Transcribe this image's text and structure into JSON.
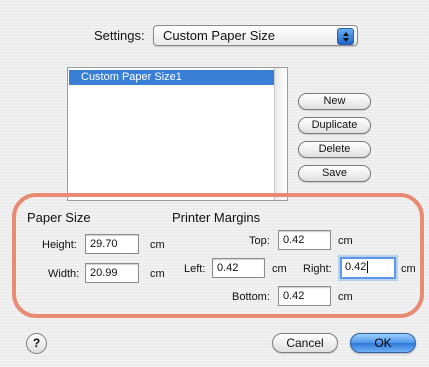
{
  "settings": {
    "label": "Settings:",
    "selected": "Custom Paper Size"
  },
  "list": {
    "items": [
      "Custom Paper Size1"
    ],
    "selected_index": 0
  },
  "side_buttons": {
    "new": "New",
    "duplicate": "Duplicate",
    "delete": "Delete",
    "save": "Save"
  },
  "paper_size": {
    "title": "Paper Size",
    "height_label": "Height:",
    "height_value": "29.70",
    "height_unit": "cm",
    "width_label": "Width:",
    "width_value": "20.99",
    "width_unit": "cm"
  },
  "printer_margins": {
    "title": "Printer Margins",
    "top_label": "Top:",
    "top_value": "0.42",
    "top_unit": "cm",
    "left_label": "Left:",
    "left_value": "0.42",
    "left_unit": "cm",
    "right_label": "Right:",
    "right_value": "0.42",
    "right_unit": "cm",
    "bottom_label": "Bottom:",
    "bottom_value": "0.42",
    "bottom_unit": "cm"
  },
  "footer": {
    "help": "?",
    "cancel": "Cancel",
    "ok": "OK"
  },
  "colors": {
    "selection": "#3a7fd6",
    "highlight_ring": "#e88a74",
    "focus": "#5c98e8",
    "default_button": "#4f97ea"
  }
}
